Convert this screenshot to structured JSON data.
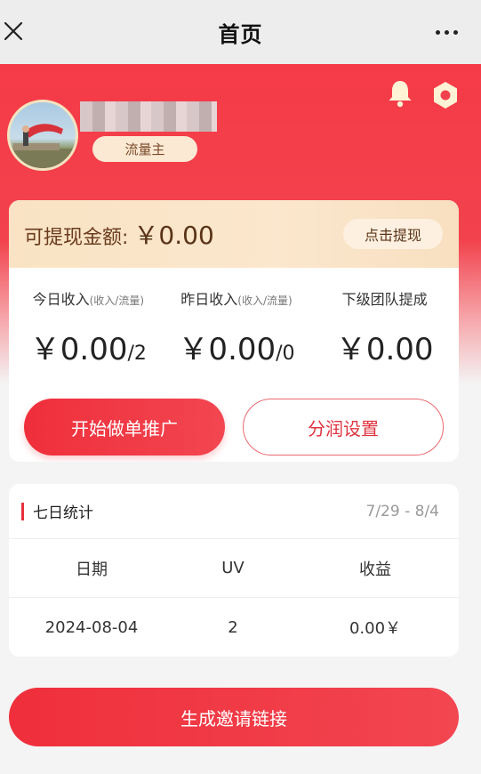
{
  "nav": {
    "title": "首页"
  },
  "profile": {
    "role": "流量主"
  },
  "balance": {
    "label": "可提现金额:",
    "value": "￥0.00",
    "withdraw_label": "点击提现"
  },
  "stats": [
    {
      "label": "今日收入",
      "sub": "(收入/流量)",
      "value": "￥0.00",
      "count": "/2"
    },
    {
      "label": "昨日收入",
      "sub": "(收入/流量)",
      "value": "￥0.00",
      "count": "/0"
    },
    {
      "label": "下级团队提成",
      "sub": "",
      "value": "￥0.00",
      "count": ""
    }
  ],
  "actions": {
    "start_label": "开始做单推广",
    "profit_label": "分润设置"
  },
  "weekly": {
    "title": "七日统计",
    "range": "7/29 - 8/4",
    "columns": [
      "日期",
      "UV",
      "收益"
    ],
    "rows": [
      [
        "2024-08-04",
        "2",
        "0.00￥"
      ]
    ]
  },
  "invite_label": "生成邀请链接",
  "colors": {
    "primary": "#f03a45",
    "gold": "#fbe7cd"
  }
}
